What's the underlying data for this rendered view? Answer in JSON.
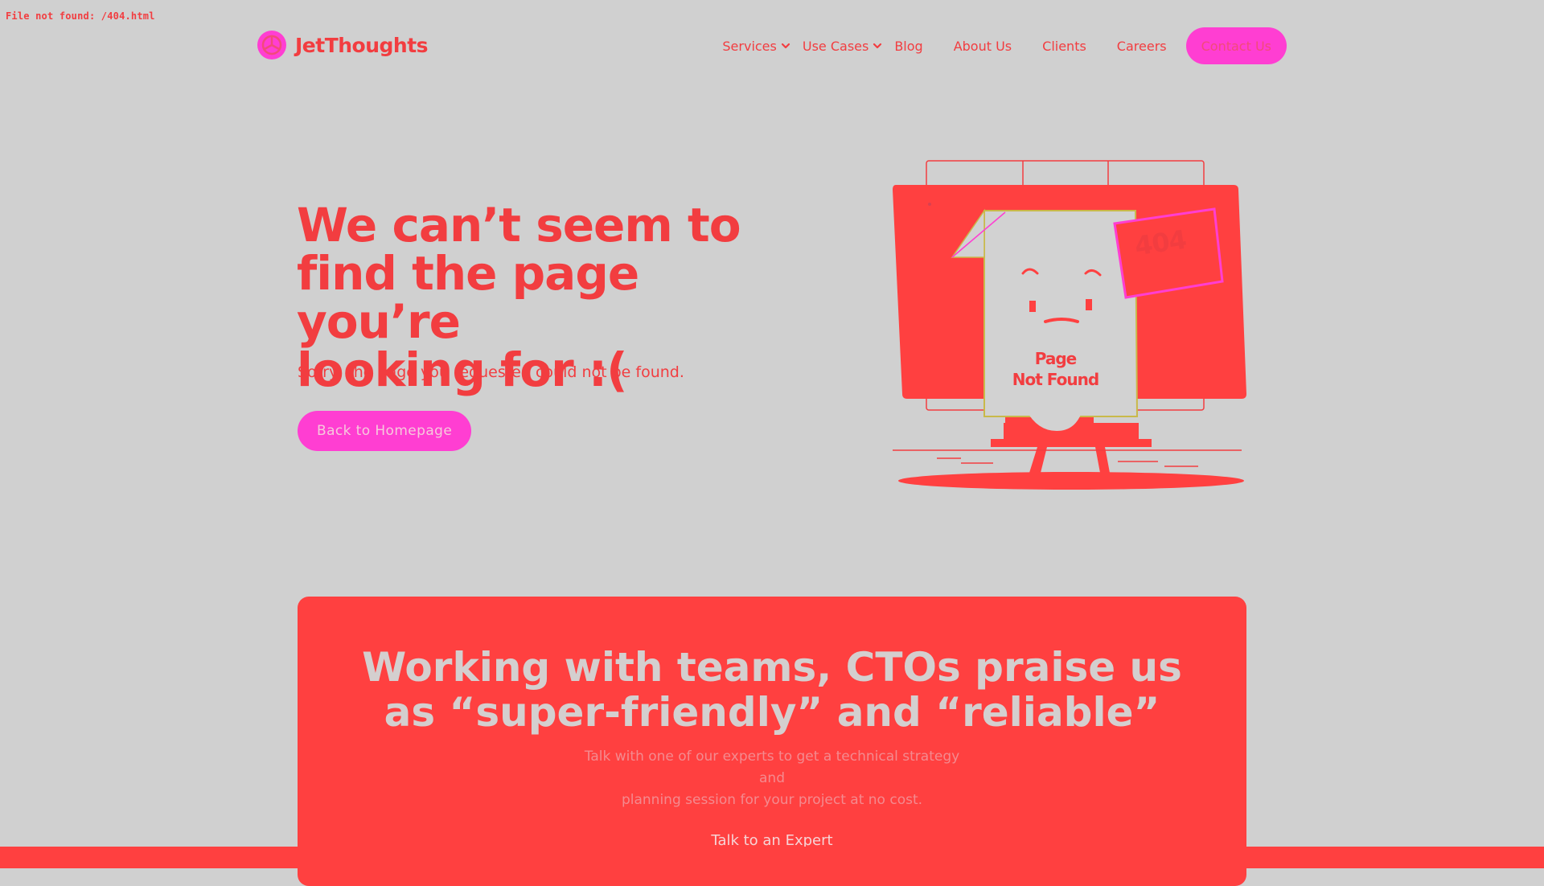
{
  "debug_message": "File not found: /404.html",
  "header": {
    "logo_text": "JetThoughts",
    "nav": [
      {
        "label": "Services",
        "has_dropdown": true
      },
      {
        "label": "Use Cases",
        "has_dropdown": true
      },
      {
        "label": "Blog",
        "has_dropdown": false
      },
      {
        "label": "About Us",
        "has_dropdown": false
      },
      {
        "label": "Clients",
        "has_dropdown": false
      },
      {
        "label": "Careers",
        "has_dropdown": false
      }
    ],
    "contact_label": "Contact Us"
  },
  "hero": {
    "title_lines": [
      "We can’t seem to",
      "find the page you’re",
      "looking for :("
    ],
    "subtitle": "Sorry, the page you requested could not be found.",
    "button_label": "Back to Homepage"
  },
  "illustration": {
    "page_label_lines": [
      "Page",
      "Not Found"
    ],
    "sticker_label": "404"
  },
  "cta": {
    "title_lines": [
      "Working with teams, CTOs praise us",
      "as “super-friendly” and “reliable”"
    ],
    "text_lines": [
      "Talk with one of our experts to get a technical strategy and",
      "planning session for your project at no cost."
    ],
    "link_label": "Talk to an Expert"
  },
  "colors": {
    "background": "#d0d0d0",
    "accent_red": "#f23d40",
    "accent_pink": "#ff3ed2",
    "cta_background": "#ff4040"
  },
  "icons": [
    "logo-mark-icon",
    "chevron-down-icon"
  ]
}
